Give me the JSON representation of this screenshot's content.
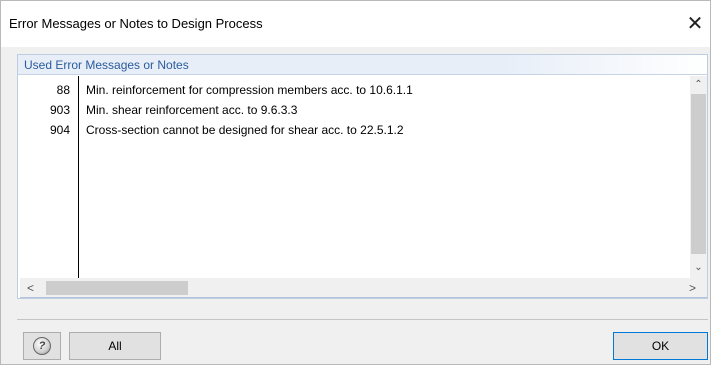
{
  "window": {
    "title": "Error Messages or Notes to Design Process",
    "close_glyph": "✕"
  },
  "group": {
    "title": "Used Error Messages or Notes"
  },
  "messages": [
    {
      "number": "88",
      "text": "Min. reinforcement for compression members acc. to 10.6.1.1"
    },
    {
      "number": "903",
      "text": "Min. shear reinforcement acc. to 9.6.3.3"
    },
    {
      "number": "904",
      "text": "Cross-section cannot be designed for shear acc. to 22.5.1.2"
    }
  ],
  "scrollbars": {
    "up_glyph": "⌃",
    "down_glyph": "⌄",
    "left_glyph": "<",
    "right_glyph": ">"
  },
  "buttons": {
    "help_glyph": "?",
    "all_label": "All",
    "ok_label": "OK"
  },
  "colors": {
    "group_title": "#2a5b9b",
    "ok_border": "#0078d7"
  }
}
